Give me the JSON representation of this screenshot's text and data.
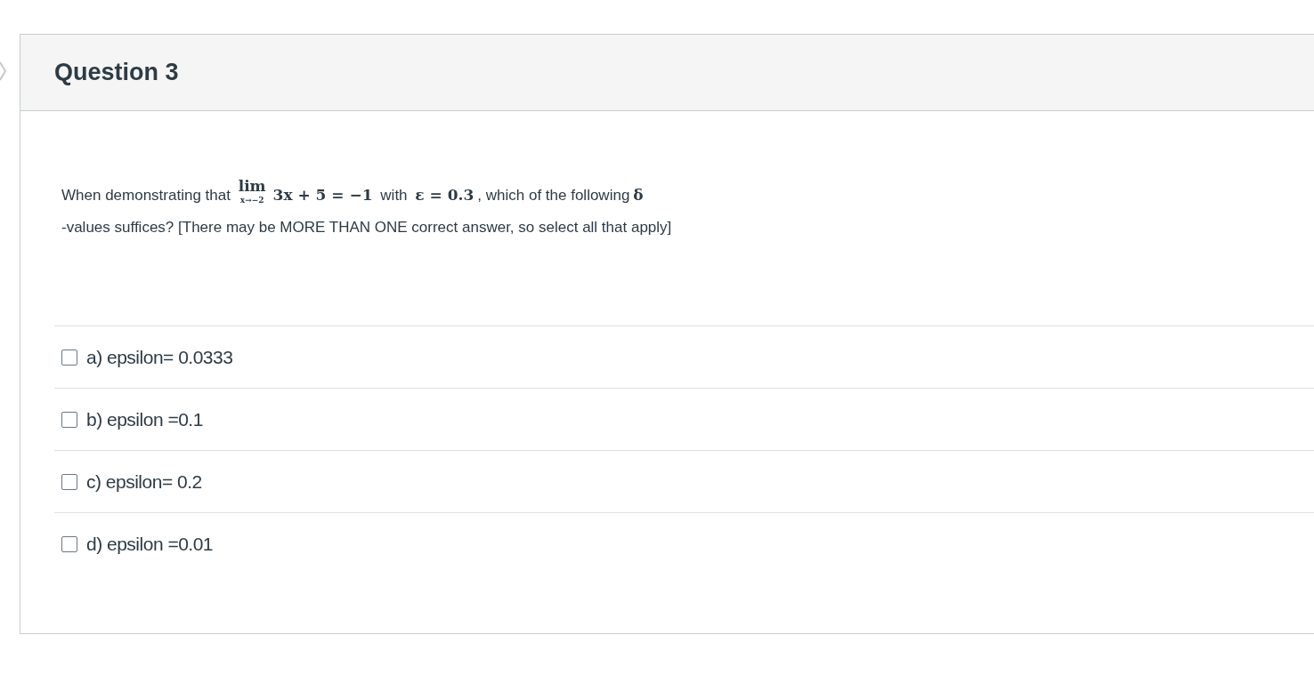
{
  "question": {
    "title": "Question 3",
    "prompt": [
      {
        "kind": "text",
        "text": "When demonstrating that"
      },
      {
        "kind": "limit",
        "label": "lim",
        "sub": "x→−2"
      },
      {
        "kind": "math",
        "text": "3x + 5 = −1"
      },
      {
        "kind": "text",
        "text": "with"
      },
      {
        "kind": "math",
        "text": "ε = 0.3"
      },
      {
        "kind": "text",
        "text": ", which of the following"
      },
      {
        "kind": "math",
        "text": "δ"
      },
      {
        "kind": "break"
      },
      {
        "kind": "text",
        "text": "-values suffices? [There may be MORE THAN ONE correct answer, so select all that apply]"
      }
    ],
    "options": [
      {
        "label": "a) epsilon= 0.0333",
        "checked": false
      },
      {
        "label": "b) epsilon =0.1",
        "checked": false
      },
      {
        "label": "c) epsilon= 0.2",
        "checked": false
      },
      {
        "label": "d) epsilon =0.01",
        "checked": false
      }
    ]
  }
}
